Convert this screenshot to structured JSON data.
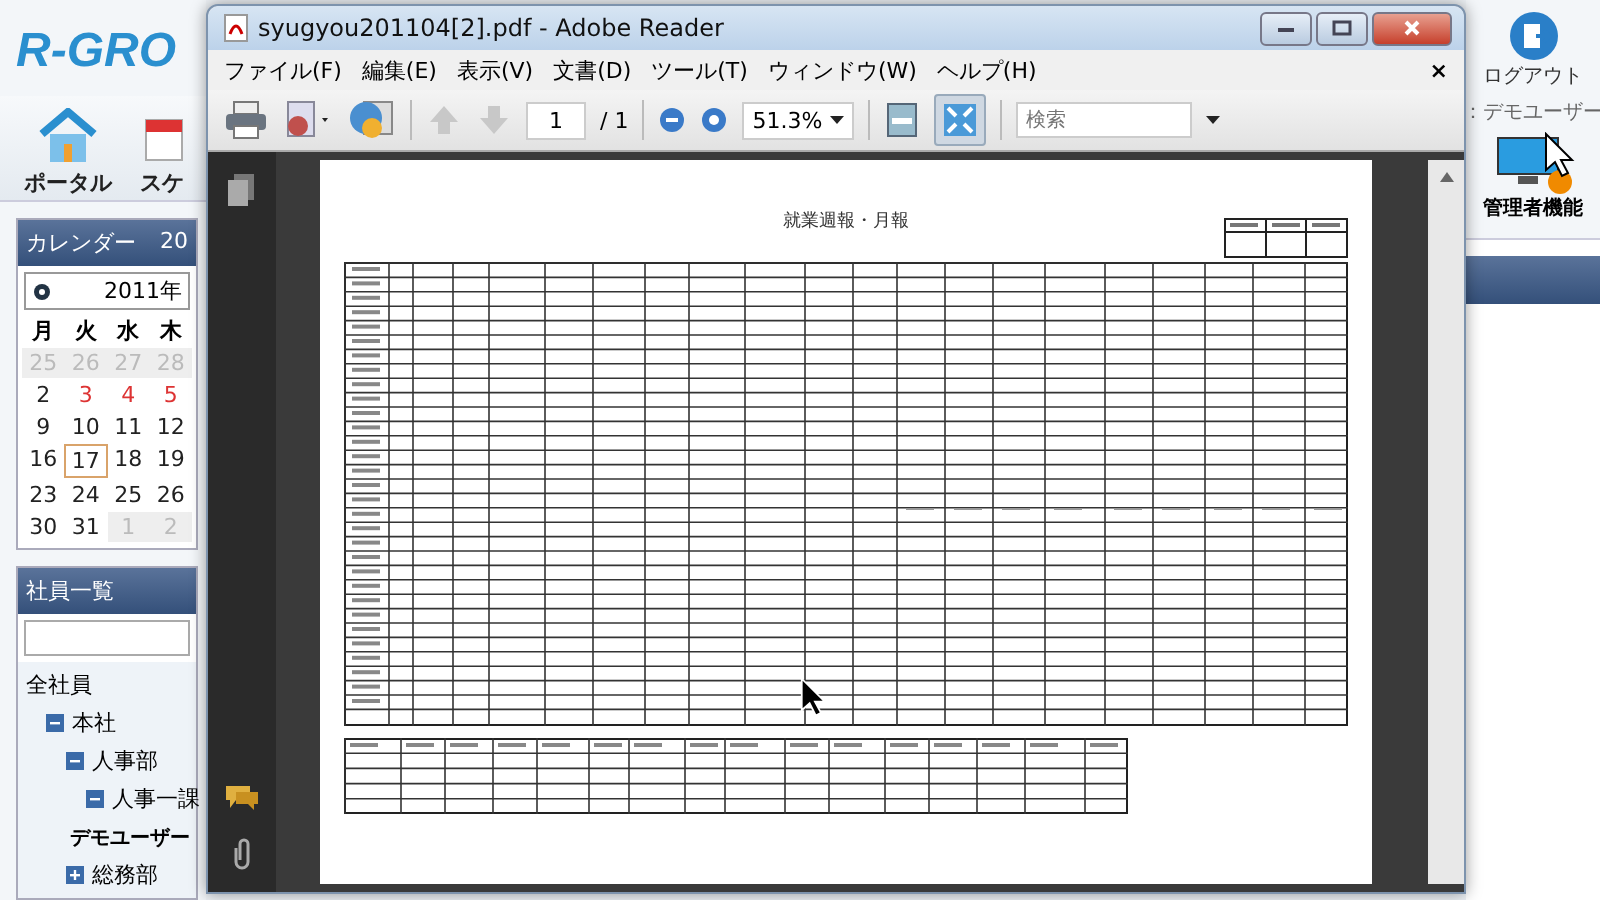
{
  "app": {
    "logo": "R-GRO",
    "nav": [
      {
        "label": "ポータル"
      },
      {
        "label": "スケ"
      }
    ],
    "logout": "ログアウト",
    "user": "：デモユーザー",
    "admin": "管理者機能"
  },
  "calendar": {
    "title": "カレンダー",
    "title_suffix": "20",
    "month": "2011年",
    "weekdays": [
      "月",
      "火",
      "水",
      "木"
    ],
    "days": [
      {
        "label": "25",
        "kind": "other",
        "selected": false
      },
      {
        "label": "26",
        "kind": "other",
        "selected": false
      },
      {
        "label": "27",
        "kind": "other",
        "selected": false
      },
      {
        "label": "28",
        "kind": "other",
        "selected": false
      },
      {
        "label": "2",
        "kind": "normal",
        "selected": false
      },
      {
        "label": "3",
        "kind": "holiday",
        "selected": false
      },
      {
        "label": "4",
        "kind": "holiday",
        "selected": false
      },
      {
        "label": "5",
        "kind": "holiday",
        "selected": false
      },
      {
        "label": "9",
        "kind": "normal",
        "selected": false
      },
      {
        "label": "10",
        "kind": "normal",
        "selected": false
      },
      {
        "label": "11",
        "kind": "normal",
        "selected": false
      },
      {
        "label": "12",
        "kind": "normal",
        "selected": false
      },
      {
        "label": "16",
        "kind": "normal",
        "selected": false
      },
      {
        "label": "17",
        "kind": "normal",
        "selected": true
      },
      {
        "label": "18",
        "kind": "normal",
        "selected": false
      },
      {
        "label": "19",
        "kind": "normal",
        "selected": false
      },
      {
        "label": "23",
        "kind": "normal",
        "selected": false
      },
      {
        "label": "24",
        "kind": "normal",
        "selected": false
      },
      {
        "label": "25",
        "kind": "normal",
        "selected": false
      },
      {
        "label": "26",
        "kind": "normal",
        "selected": false
      },
      {
        "label": "30",
        "kind": "normal",
        "selected": false
      },
      {
        "label": "31",
        "kind": "normal",
        "selected": false
      },
      {
        "label": "1",
        "kind": "other",
        "selected": false
      },
      {
        "label": "2",
        "kind": "other",
        "selected": false
      }
    ]
  },
  "employees": {
    "title": "社員一覧",
    "tree": [
      {
        "label": "全社員",
        "children": [
          {
            "label": "本社",
            "expanded": true,
            "children": [
              {
                "label": "人事部",
                "expanded": true,
                "children": [
                  {
                    "label": "人事一課",
                    "expanded": true,
                    "children": [
                      {
                        "label": "デモユーザー"
                      }
                    ]
                  }
                ]
              },
              {
                "label": "総務部",
                "expanded": false
              }
            ]
          }
        ]
      }
    ]
  },
  "reader": {
    "title": "syugyou201104[2].pdf - Adobe Reader",
    "menu": [
      "ファイル(F)",
      "編集(E)",
      "表示(V)",
      "文書(D)",
      "ツール(T)",
      "ウィンドウ(W)",
      "ヘルプ(H)"
    ],
    "menu_close": "×",
    "page": "1",
    "page_total": "/ 1",
    "zoom": "51.3%",
    "search_placeholder": "検索",
    "prev_disabled": true,
    "next_disabled": true,
    "fit_page_selected": true,
    "document": {
      "title": "就業週報・月報"
    }
  }
}
